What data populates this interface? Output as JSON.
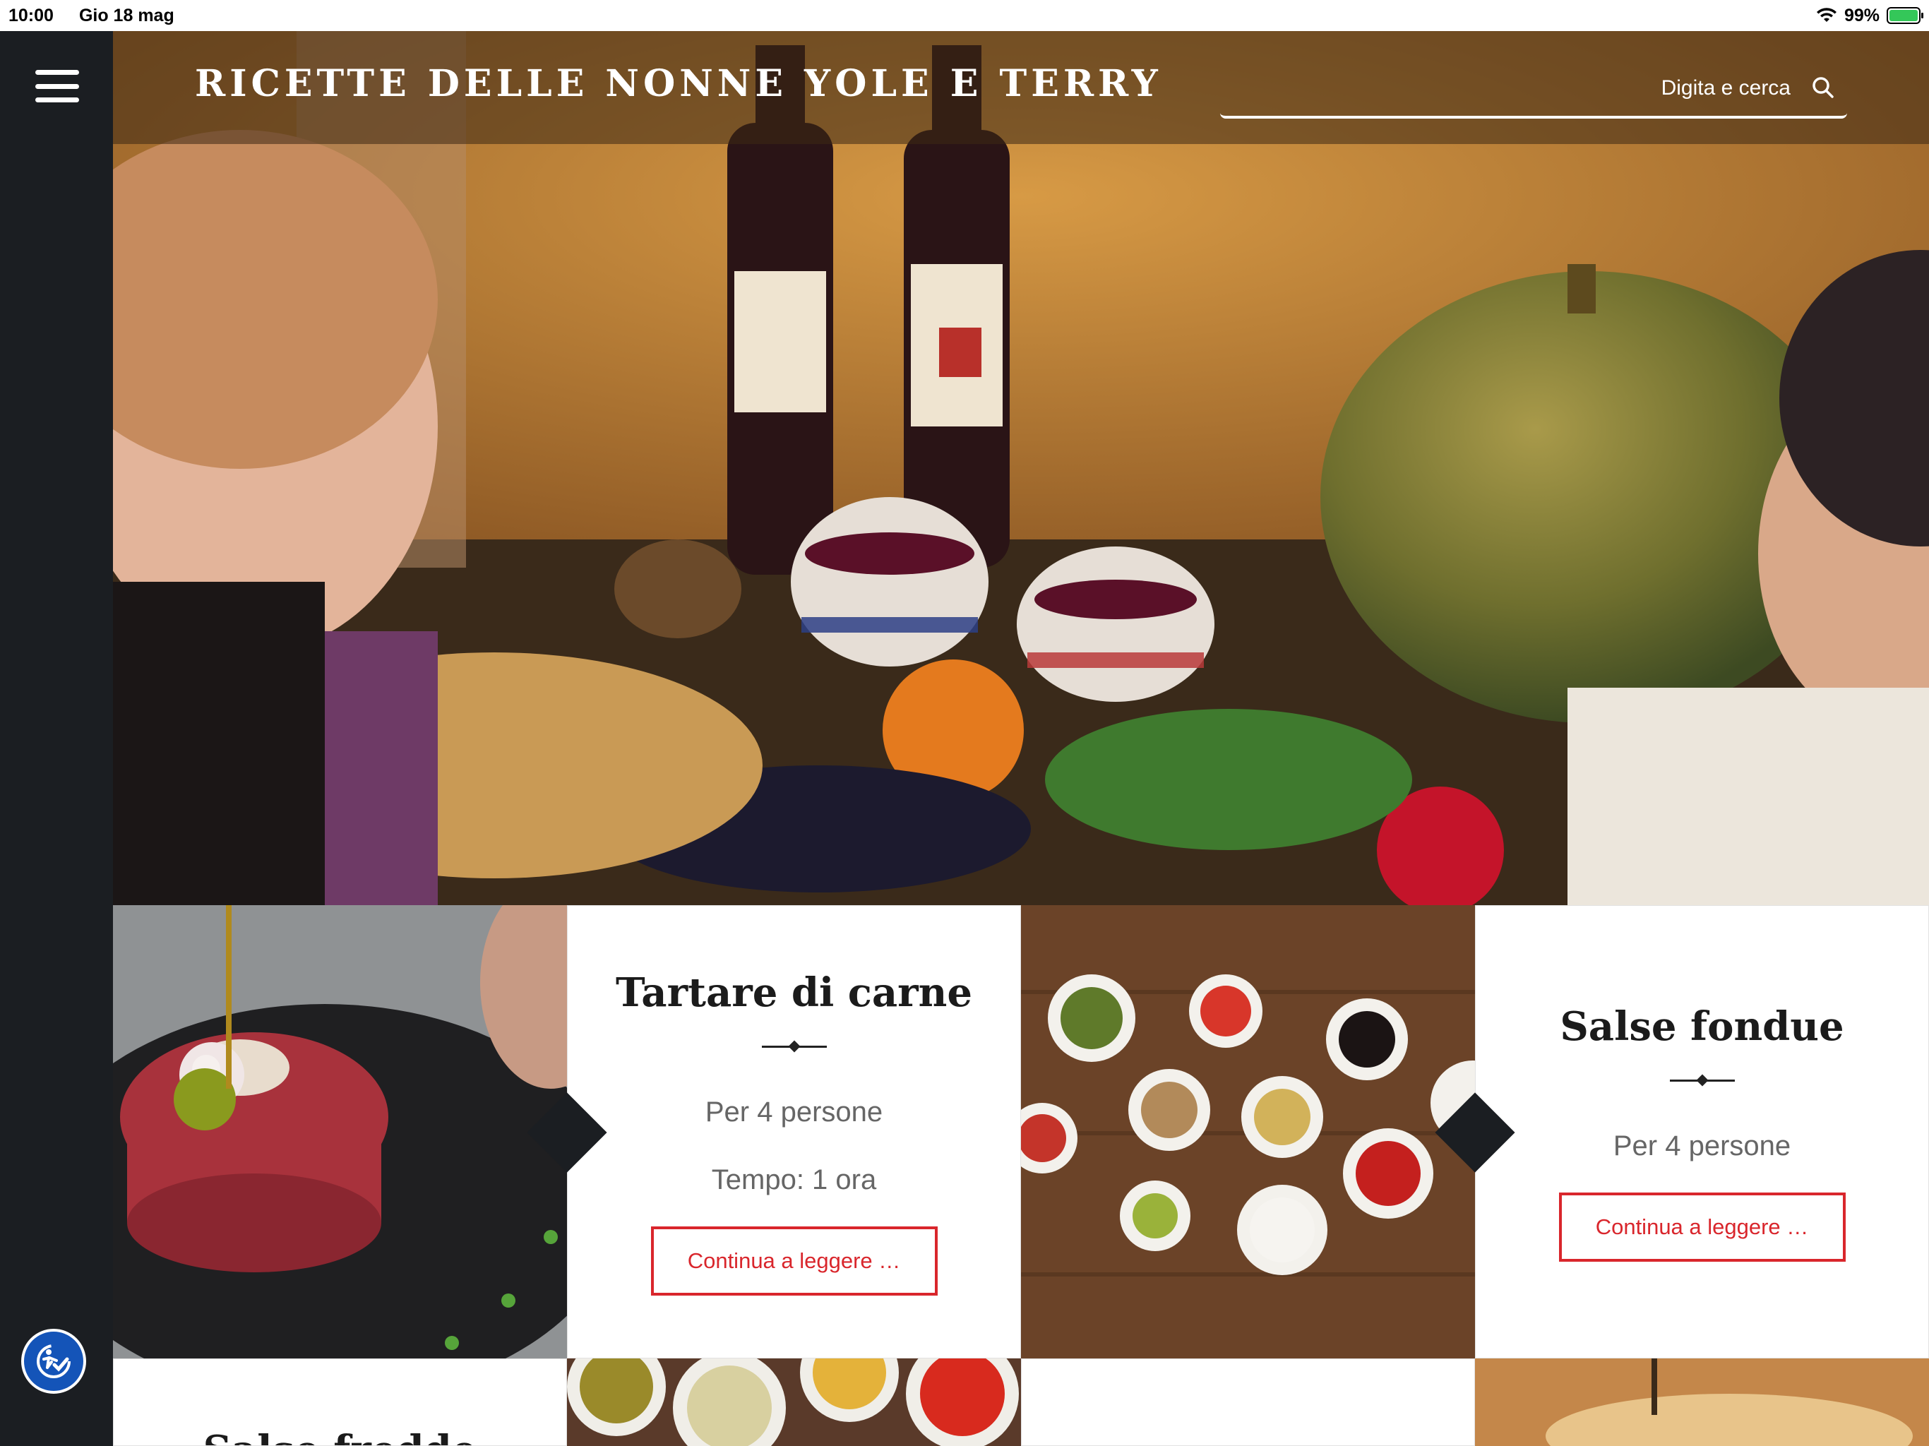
{
  "status_bar": {
    "time": "10:00",
    "date": "Gio 18 mag",
    "battery": "99%"
  },
  "header": {
    "site_title": "RICETTE DELLE NONNE YOLE E TERRY",
    "search_placeholder": "Digita e cerca"
  },
  "recipes": [
    {
      "title": "Tartare di carne",
      "servings": "Per 4 persone",
      "time": "Tempo: 1 ora",
      "read_more": "Continua a leggere …"
    },
    {
      "title": "Salse fondue",
      "servings": "Per 4 persone",
      "read_more": "Continua a leggere …"
    }
  ],
  "next_row": {
    "partial_title": "Salse fredde"
  },
  "colors": {
    "sidebar": "#1b1e22",
    "accent_red": "#d9262c",
    "a11y_blue": "#1454b8"
  },
  "icons": [
    "menu-icon",
    "search-icon",
    "accessibility-icon",
    "wifi-icon",
    "battery-icon"
  ]
}
